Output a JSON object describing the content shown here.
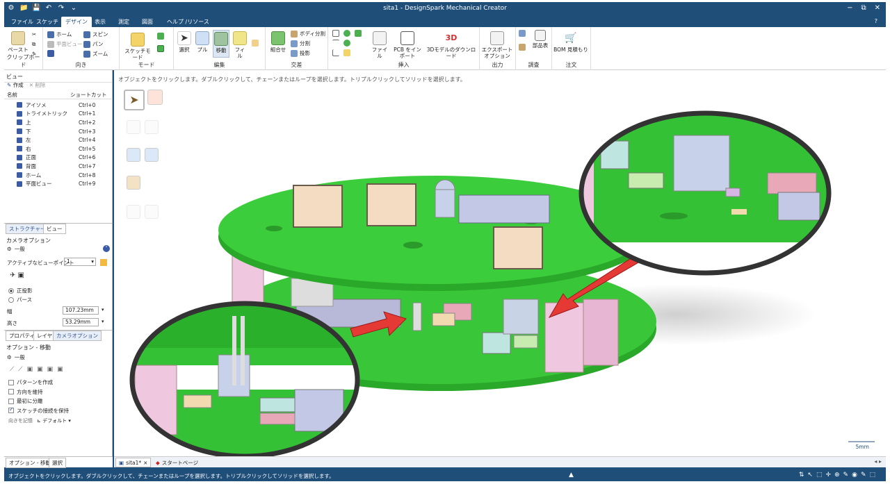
{
  "app": {
    "title": "sita1 - DesignSpark Mechanical Creator"
  },
  "window_controls": [
    "−",
    "⧉",
    "✕"
  ],
  "quick_access": [
    "⚙",
    "📁",
    "💾",
    "↶",
    "↷",
    "⌄"
  ],
  "tabs": [
    {
      "label": "ファイル",
      "active": false
    },
    {
      "label": "スケッチ",
      "active": false
    },
    {
      "label": "デザイン",
      "active": true
    },
    {
      "label": "表示",
      "active": false
    },
    {
      "label": "測定",
      "active": false
    },
    {
      "label": "図面",
      "active": false
    },
    {
      "label": "ヘルプ /リソース",
      "active": false
    }
  ],
  "ribbon": {
    "clipboard": {
      "paste": "ペースト",
      "group": "クリップボード"
    },
    "orient": {
      "home": "ホーム",
      "plane_view": "平面ビュー",
      "spin": "スピン",
      "pan": "パン",
      "zoom": "ズーム",
      "group": "向き"
    },
    "mode": {
      "sketch_mode": "スケッチモード",
      "group": "モード"
    },
    "edit": {
      "select": "選択",
      "pull": "プル",
      "move": "移動",
      "fill": "フィル",
      "group": "編集"
    },
    "intersect": {
      "combine": "組合せ",
      "split_body": "ボディ分割",
      "split": "分割",
      "project": "投影",
      "group": "交差"
    },
    "insert": {
      "file": "ファイル",
      "pcb": "PCB をインポート",
      "model3d": "3Dモデルのダウンロード",
      "group": "挿入"
    },
    "output": {
      "export": "エクスポートオプション",
      "group": "出力"
    },
    "investigate": {
      "parts": "部品表",
      "group": "調査"
    },
    "order": {
      "bom": "BOM 見積もり",
      "group": "注文"
    }
  },
  "view_panel": {
    "title": "ビュー",
    "create": "作成",
    "delete": "削除",
    "col_name": "名前",
    "col_shortcut": "ショートカット",
    "rows": [
      {
        "name": "アイソメ",
        "shortcut": "Ctrl+0"
      },
      {
        "name": "トライメトリック",
        "shortcut": "Ctrl+1"
      },
      {
        "name": "上",
        "shortcut": "Ctrl+2"
      },
      {
        "name": "下",
        "shortcut": "Ctrl+3"
      },
      {
        "name": "左",
        "shortcut": "Ctrl+4"
      },
      {
        "name": "右",
        "shortcut": "Ctrl+5"
      },
      {
        "name": "正面",
        "shortcut": "Ctrl+6"
      },
      {
        "name": "背面",
        "shortcut": "Ctrl+7"
      },
      {
        "name": "ホーム",
        "shortcut": "Ctrl+8"
      },
      {
        "name": "平面ビュー",
        "shortcut": "Ctrl+9"
      }
    ],
    "tab_structure": "ストラクチャー",
    "tab_view": "ビュー"
  },
  "camera": {
    "title": "カメラオプション",
    "general": "一般",
    "active_viewpoint_label": "アクティブなビューポイント",
    "active_viewpoint": "1",
    "ortho": "正投影",
    "persp": "パース",
    "width_label": "幅",
    "width": "107.23mm",
    "height_label": "高さ",
    "height": "53.29mm"
  },
  "prop_tabs": [
    "プロパティ",
    "レイヤ",
    "カメラオプション"
  ],
  "options_move": {
    "title": "オプション - 移動",
    "general": "一般",
    "checks": [
      {
        "label": "パターンを作成",
        "checked": false
      },
      {
        "label": "方向を維持",
        "checked": false
      },
      {
        "label": "最初に分離",
        "checked": false
      },
      {
        "label": "スケッチの接続を保持",
        "checked": true
      }
    ],
    "orient_label": "向きを記憶",
    "orient_value": "デフォルト"
  },
  "bottom_tabs": [
    "オプション - 移動",
    "選択"
  ],
  "viewport": {
    "hint": "オブジェクトをクリックします。ダブルクリックして、チェーンまたはループを選択します。トリプルクリックしてソリッドを選択します。",
    "scale": "5mm"
  },
  "doc_tabs": [
    "sita1*",
    "スタートページ"
  ],
  "status": "オブジェクトをクリックします。ダブルクリックして、チェーンまたはループを選択します。トリプルクリックしてソリッドを選択します。"
}
